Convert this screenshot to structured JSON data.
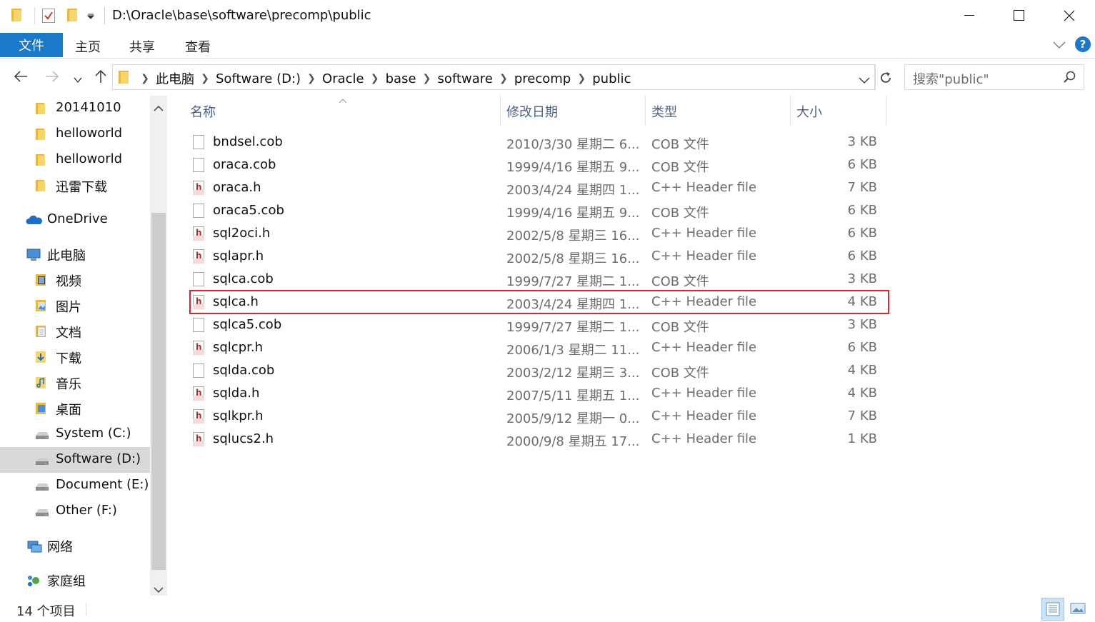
{
  "window": {
    "title": "D:\\Oracle\\base\\software\\precomp\\public",
    "minimize_icon": "minimize-icon",
    "maximize_icon": "maximize-icon",
    "close_icon": "close-icon"
  },
  "ribbon": {
    "tabs": [
      {
        "label": "文件"
      },
      {
        "label": "主页"
      },
      {
        "label": "共享"
      },
      {
        "label": "查看"
      }
    ],
    "help_label": "?"
  },
  "address": {
    "crumbs": [
      "此电脑",
      "Software (D:)",
      "Oracle",
      "base",
      "software",
      "precomp",
      "public"
    ]
  },
  "search": {
    "placeholder": "搜索\"public\""
  },
  "navpane": {
    "items": [
      {
        "label": "20141010",
        "icon": "folder-icon"
      },
      {
        "label": "helloworld",
        "icon": "folder-icon"
      },
      {
        "label": "helloworld",
        "icon": "folder-icon"
      },
      {
        "label": "迅雷下载",
        "icon": "folder-icon"
      },
      {
        "label": "OneDrive",
        "icon": "cloud-icon"
      },
      {
        "label": "此电脑",
        "icon": "computer-icon"
      },
      {
        "label": "视频",
        "icon": "video-folder-icon"
      },
      {
        "label": "图片",
        "icon": "pictures-folder-icon"
      },
      {
        "label": "文档",
        "icon": "documents-folder-icon"
      },
      {
        "label": "下载",
        "icon": "downloads-folder-icon"
      },
      {
        "label": "音乐",
        "icon": "music-folder-icon"
      },
      {
        "label": "桌面",
        "icon": "desktop-folder-icon"
      },
      {
        "label": "System (C:)",
        "icon": "drive-icon"
      },
      {
        "label": "Software (D:)",
        "icon": "drive-icon"
      },
      {
        "label": "Document (E:)",
        "icon": "drive-icon"
      },
      {
        "label": "Other (F:)",
        "icon": "drive-icon"
      },
      {
        "label": "网络",
        "icon": "network-icon"
      },
      {
        "label": "家庭组",
        "icon": "homegroup-icon"
      }
    ],
    "selected": "Software (D:)"
  },
  "filelist": {
    "columns": [
      "名称",
      "修改日期",
      "类型",
      "大小"
    ],
    "rows": [
      {
        "name": "bndsel.cob",
        "date": "2010/3/30 星期二 6...",
        "type": "COB 文件",
        "size": "3 KB",
        "kind": "cob"
      },
      {
        "name": "oraca.cob",
        "date": "1999/4/16 星期五 9...",
        "type": "COB 文件",
        "size": "6 KB",
        "kind": "cob"
      },
      {
        "name": "oraca.h",
        "date": "2003/4/24 星期四 1...",
        "type": "C++ Header file",
        "size": "7 KB",
        "kind": "h"
      },
      {
        "name": "oraca5.cob",
        "date": "1999/4/16 星期五 9...",
        "type": "COB 文件",
        "size": "6 KB",
        "kind": "cob"
      },
      {
        "name": "sql2oci.h",
        "date": "2002/5/8 星期三 16...",
        "type": "C++ Header file",
        "size": "6 KB",
        "kind": "h"
      },
      {
        "name": "sqlapr.h",
        "date": "2002/5/8 星期三 16...",
        "type": "C++ Header file",
        "size": "6 KB",
        "kind": "h"
      },
      {
        "name": "sqlca.cob",
        "date": "1999/7/27 星期二 1...",
        "type": "COB 文件",
        "size": "3 KB",
        "kind": "cob"
      },
      {
        "name": "sqlca.h",
        "date": "2003/4/24 星期四 1...",
        "type": "C++ Header file",
        "size": "4 KB",
        "kind": "h",
        "highlighted": true
      },
      {
        "name": "sqlca5.cob",
        "date": "1999/7/27 星期二 1...",
        "type": "COB 文件",
        "size": "3 KB",
        "kind": "cob"
      },
      {
        "name": "sqlcpr.h",
        "date": "2006/1/3 星期二 11...",
        "type": "C++ Header file",
        "size": "6 KB",
        "kind": "h"
      },
      {
        "name": "sqlda.cob",
        "date": "2003/2/12 星期三 3...",
        "type": "COB 文件",
        "size": "4 KB",
        "kind": "cob"
      },
      {
        "name": "sqlda.h",
        "date": "2007/5/11 星期五 1...",
        "type": "C++ Header file",
        "size": "4 KB",
        "kind": "h"
      },
      {
        "name": "sqlkpr.h",
        "date": "2005/9/12 星期一 0...",
        "type": "C++ Header file",
        "size": "7 KB",
        "kind": "h"
      },
      {
        "name": "sqlucs2.h",
        "date": "2000/9/8 星期五 17...",
        "type": "C++ Header file",
        "size": "1 KB",
        "kind": "h"
      }
    ]
  },
  "status": {
    "item_count": "14 个项目"
  },
  "colors": {
    "accent": "#1979ca",
    "highlight_box": "#e0262b",
    "header_text": "#4d6185",
    "selected_nav": "#d9d9d9"
  }
}
